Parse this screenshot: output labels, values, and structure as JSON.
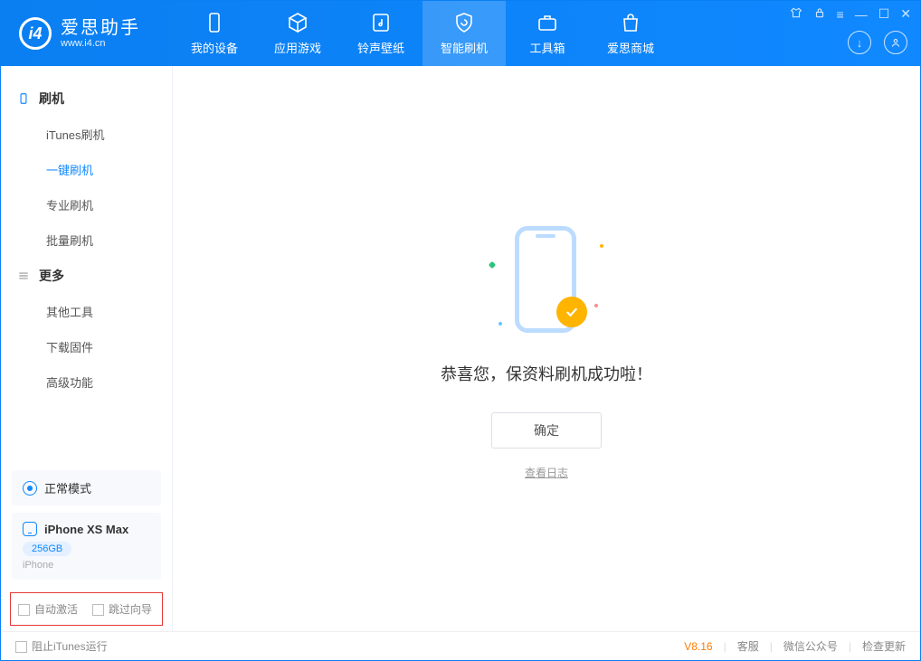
{
  "app": {
    "title": "爱思助手",
    "url": "www.i4.cn"
  },
  "tabs": [
    {
      "label": "我的设备"
    },
    {
      "label": "应用游戏"
    },
    {
      "label": "铃声壁纸"
    },
    {
      "label": "智能刷机"
    },
    {
      "label": "工具箱"
    },
    {
      "label": "爱思商城"
    }
  ],
  "sidebar": {
    "group1": {
      "title": "刷机",
      "items": [
        "iTunes刷机",
        "一键刷机",
        "专业刷机",
        "批量刷机"
      ]
    },
    "group2": {
      "title": "更多",
      "items": [
        "其他工具",
        "下载固件",
        "高级功能"
      ]
    }
  },
  "mode": {
    "label": "正常模式"
  },
  "device": {
    "name": "iPhone XS Max",
    "capacity": "256GB",
    "type": "iPhone"
  },
  "options": {
    "auto_activate": "自动激活",
    "skip_wizard": "跳过向导"
  },
  "result": {
    "message": "恭喜您，保资料刷机成功啦！",
    "confirm": "确定",
    "view_log": "查看日志"
  },
  "footer": {
    "block_itunes": "阻止iTunes运行",
    "version": "V8.16",
    "links": [
      "客服",
      "微信公众号",
      "检查更新"
    ]
  }
}
